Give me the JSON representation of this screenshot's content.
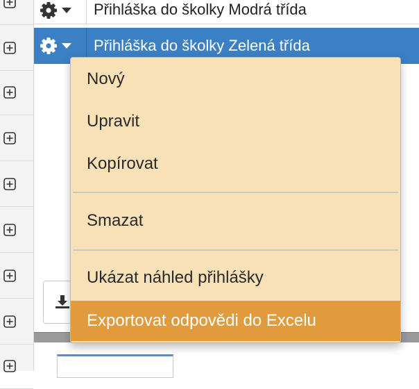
{
  "rows": [
    {
      "label": "Přihláška do školky Modrá třída"
    },
    {
      "label": "Přihláška do školky Zelená třída"
    }
  ],
  "menu": {
    "items": [
      {
        "label": "Nový"
      },
      {
        "label": "Upravit"
      },
      {
        "label": "Kopírovat"
      },
      {
        "label": "Smazat"
      },
      {
        "label": "Ukázat náhled přihlášky"
      },
      {
        "label": "Exportovat odpovědi do Excelu"
      }
    ]
  },
  "colors": {
    "selected_row": "#3b7fc4",
    "menu_bg": "#f8e0b7",
    "menu_active": "#e19a3c"
  },
  "icons": {
    "expander": "plus-square-icon",
    "row_actions": "gear-icon",
    "dropdown": "caret-down-icon",
    "download": "download-icon"
  }
}
